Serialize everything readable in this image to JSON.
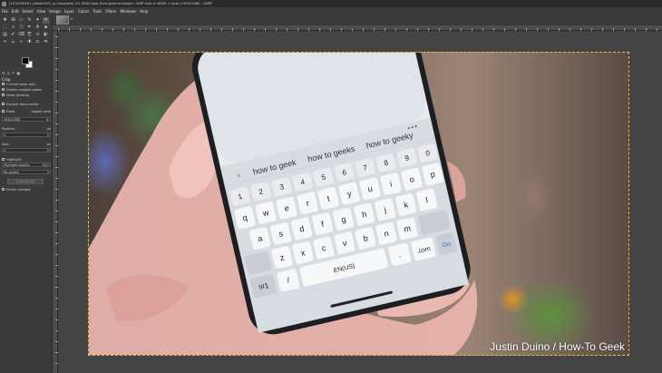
{
  "window": {
    "title": "[1470009501_Lebbe?e05_e] (imported)-3.0 (RGB color 8-bit gamma integer, GIMP built-in sRGB, 1 layer) 1920x1080 – GIMP"
  },
  "menu": [
    "File",
    "Edit",
    "Select",
    "View",
    "Image",
    "Layer",
    "Colors",
    "Tools",
    "Filters",
    "Windows",
    "Help"
  ],
  "image_tab": {
    "close_glyph": "×"
  },
  "tools": [
    {
      "icon": "move-icon",
      "glyph": "✥"
    },
    {
      "icon": "align-icon",
      "glyph": "⊞"
    },
    {
      "icon": "rect-select-icon",
      "glyph": "▭"
    },
    {
      "icon": "free-select-icon",
      "glyph": "✎"
    },
    {
      "icon": "fuzzy-select-icon",
      "glyph": "✦"
    },
    {
      "icon": "crop-icon",
      "glyph": "⌗"
    },
    {
      "icon": "unified-transform-icon",
      "glyph": "⬚"
    },
    {
      "icon": "warp-icon",
      "glyph": "∿"
    },
    {
      "icon": "cage-icon",
      "glyph": "⬡"
    },
    {
      "icon": "paths-icon",
      "glyph": "✒"
    },
    {
      "icon": "text-icon",
      "glyph": "A"
    },
    {
      "icon": "bucket-fill-icon",
      "glyph": "◈"
    },
    {
      "icon": "gradient-icon",
      "glyph": "▤"
    },
    {
      "icon": "paintbrush-icon",
      "glyph": "✐"
    },
    {
      "icon": "eraser-icon",
      "glyph": "⌫"
    },
    {
      "icon": "clone-icon",
      "glyph": "⎘"
    },
    {
      "icon": "smudge-icon",
      "glyph": "☌"
    },
    {
      "icon": "dodge-burn-icon",
      "glyph": "◐"
    },
    {
      "icon": "color-picker-icon",
      "glyph": "⌖"
    },
    {
      "icon": "measure-icon",
      "glyph": "⟂"
    },
    {
      "icon": "zoom-icon",
      "glyph": "⌕"
    },
    {
      "icon": "heal-icon",
      "glyph": "✚"
    },
    {
      "icon": "perspective-icon",
      "glyph": "⏢"
    },
    {
      "icon": "flip-icon",
      "glyph": "⇋"
    }
  ],
  "tool_options": {
    "title": "Crop",
    "current_layer_only": "Current layer only",
    "delete_cropped_pixels": "Delete cropped pixels",
    "allow_growing": "Allow growing",
    "expand_from_center": "Expand from center",
    "fixed_label": "Fixed",
    "fixed_mode": "Aspect ratio",
    "fixed_value": "1920:1080",
    "position_label": "Position:",
    "position_unit": "px",
    "position_value": "0",
    "size_label": "Size:",
    "size_unit": "px",
    "size_value": "0",
    "highlight_label": "Highlight",
    "highlight_opacity": "Highlight opacity",
    "highlight_opacity_value": "50.0",
    "guides_value": "No guides",
    "auto_shrink": "Auto Shrink",
    "shrink_merged": "Shrink merged"
  },
  "photo": {
    "credit": "Justin Duino / How-To Geek",
    "suggestions": [
      "how to geek",
      "how to geeks",
      "how to geeky"
    ],
    "number_row": [
      "1",
      "2",
      "3",
      "4",
      "5",
      "6",
      "7",
      "8",
      "9",
      "0"
    ],
    "row1": [
      "q",
      "w",
      "e",
      "r",
      "t",
      "y",
      "u",
      "i",
      "o",
      "p"
    ],
    "row2": [
      "a",
      "s",
      "d",
      "f",
      "g",
      "h",
      "j",
      "k",
      "l"
    ],
    "row3": [
      "z",
      "x",
      "c",
      "v",
      "b",
      "n",
      "m"
    ],
    "space_label": "EN(US)",
    "com_label": ".com",
    "go_label": "Go",
    "sym_label": "!#1",
    "slash_label": "/",
    "dot_label": "."
  }
}
